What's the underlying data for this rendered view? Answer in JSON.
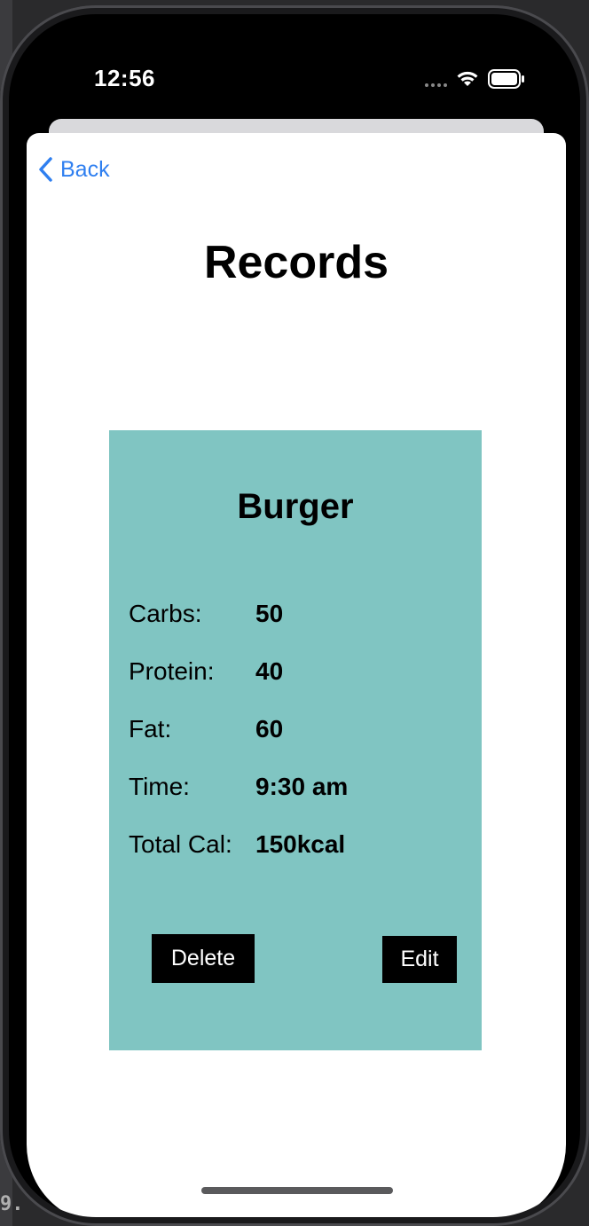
{
  "status_bar": {
    "time": "12:56"
  },
  "nav": {
    "back_label": "Back"
  },
  "page": {
    "title": "Records"
  },
  "record": {
    "name": "Burger",
    "rows": [
      {
        "label": "Carbs:",
        "value": "50"
      },
      {
        "label": "Protein:",
        "value": "40"
      },
      {
        "label": "Fat:",
        "value": "60"
      },
      {
        "label": "Time:",
        "value": "9:30 am"
      },
      {
        "label": "Total Cal:",
        "value": "150kcal"
      }
    ],
    "delete_label": "Delete",
    "edit_label": "Edit"
  },
  "background_fragment": "9.",
  "colors": {
    "accent": "#2f7ff0",
    "card": "#80c5c2",
    "button": "#000000"
  },
  "icons": {
    "back": "chevron-left-icon",
    "wifi": "wifi-icon",
    "battery": "battery-icon",
    "signal": "signal-dots-icon"
  }
}
